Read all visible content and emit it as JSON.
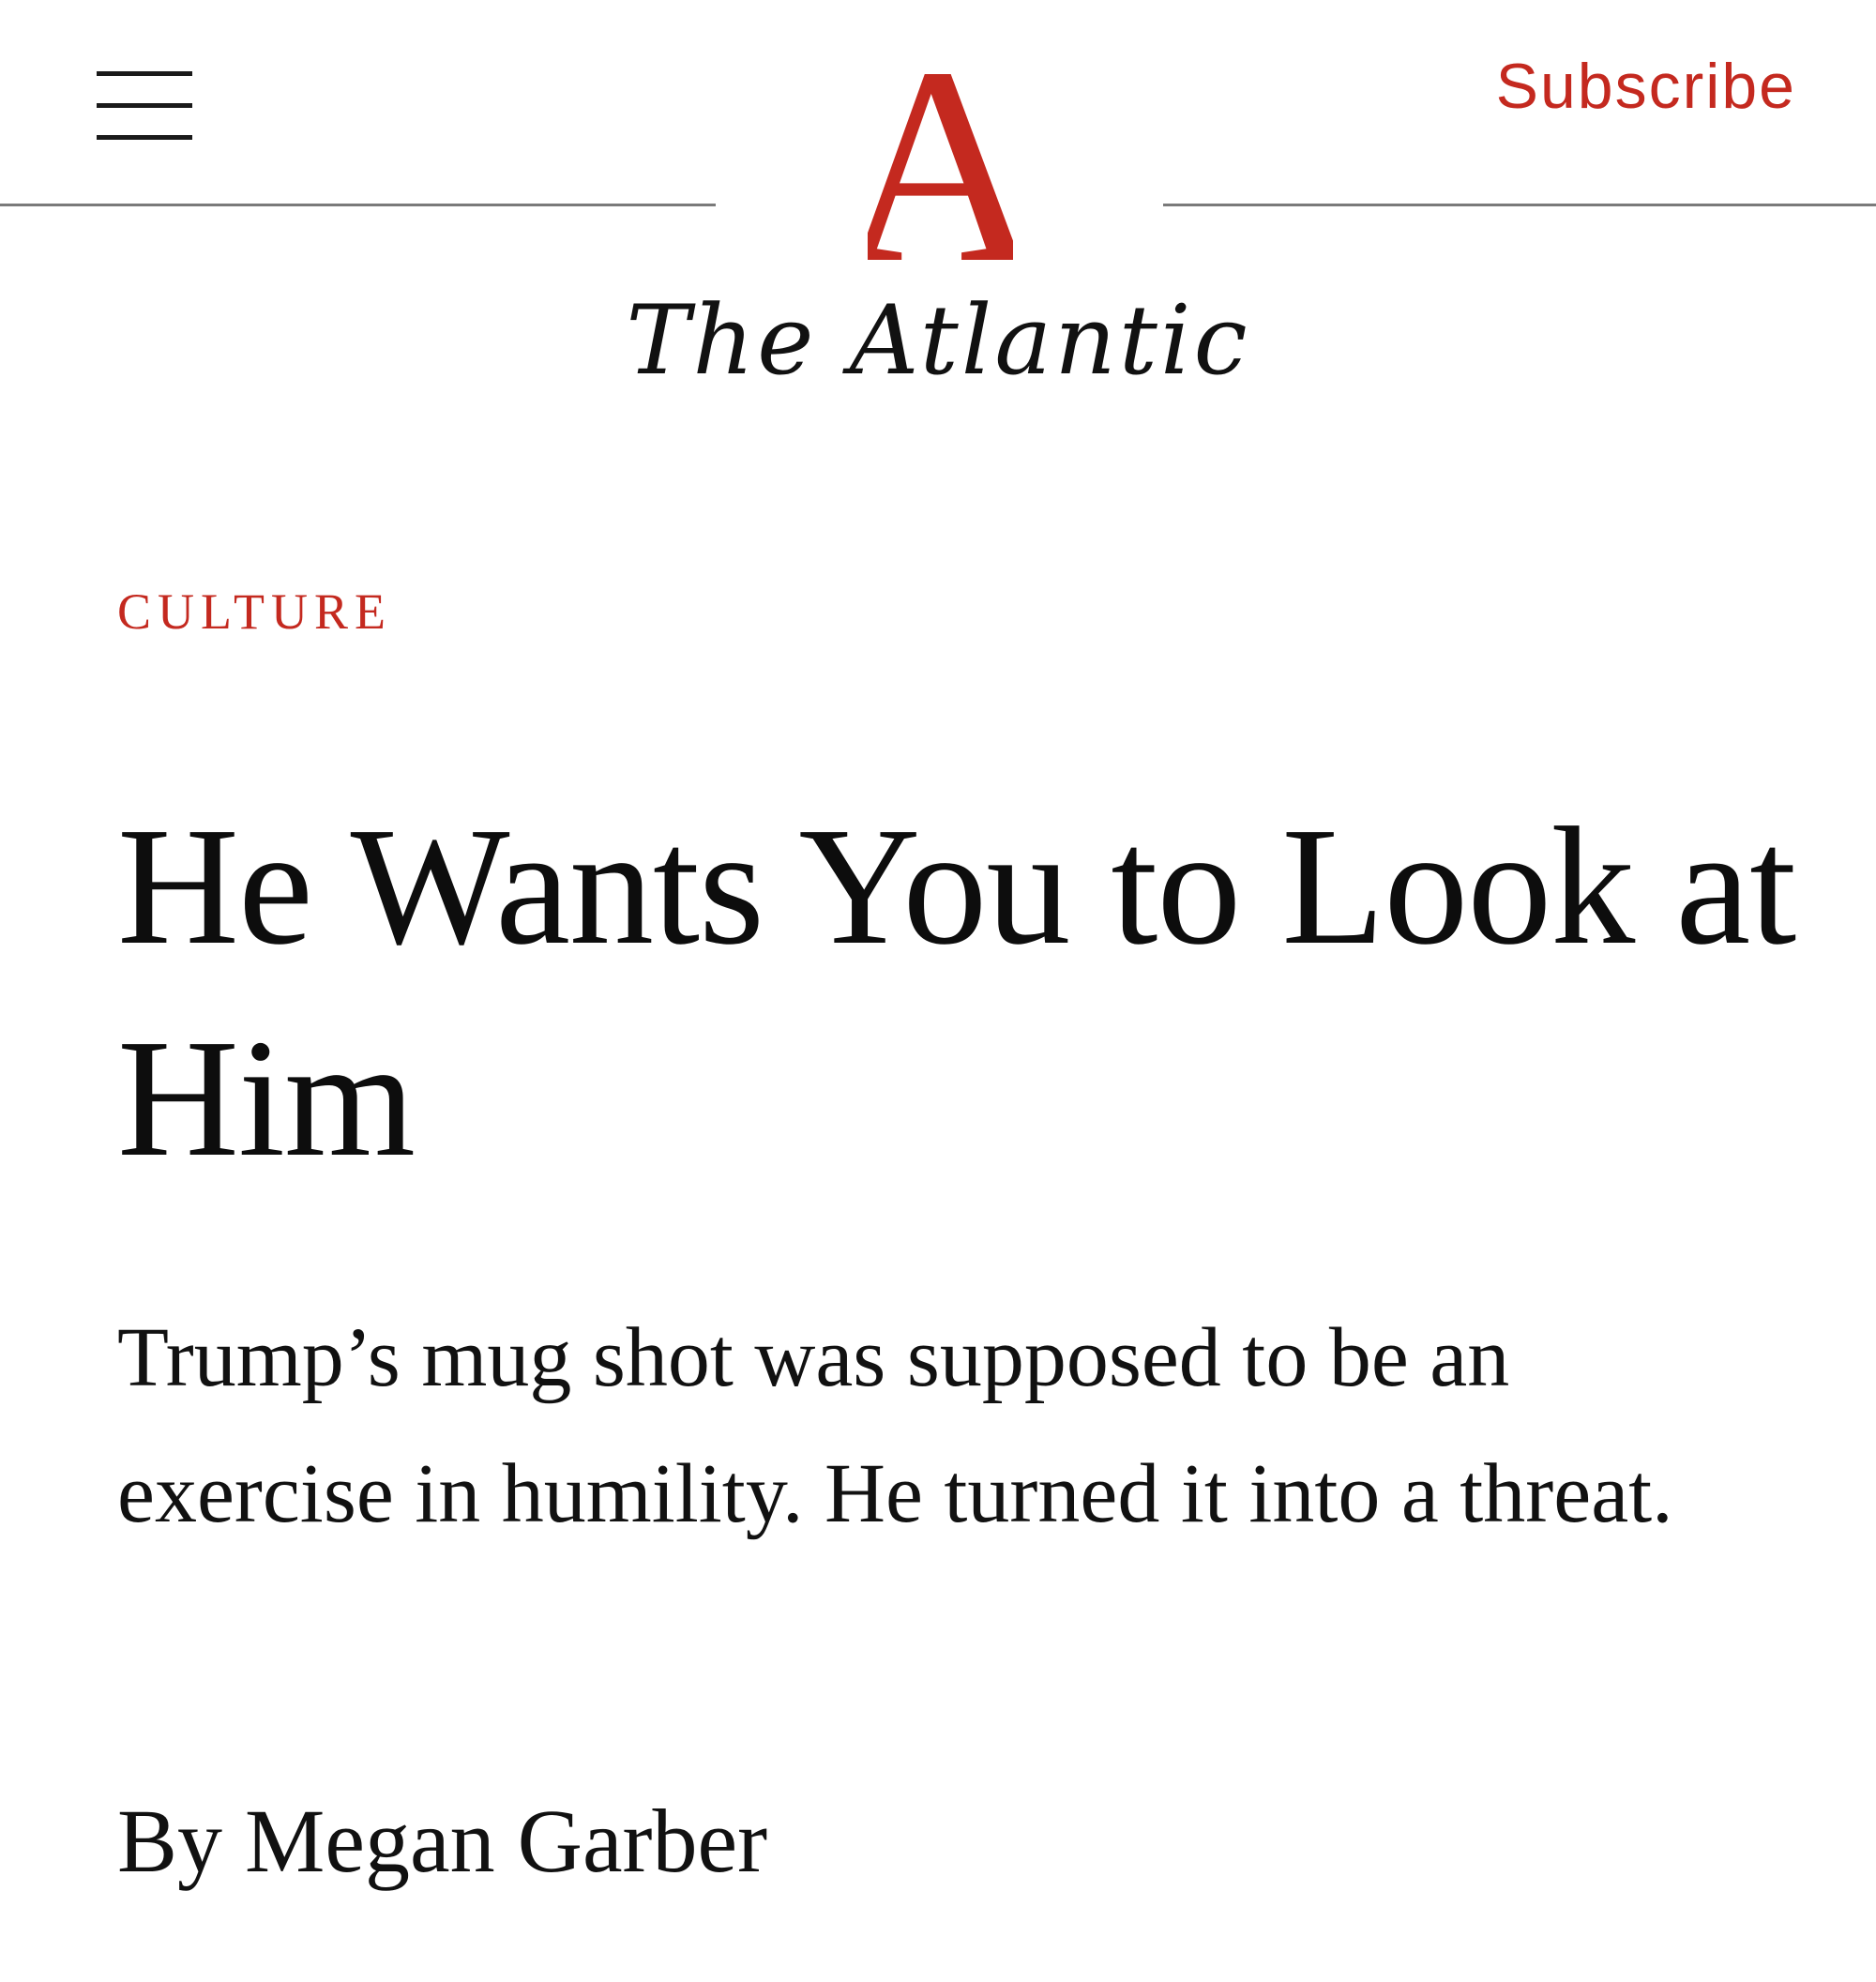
{
  "header": {
    "subscribe_label": "Subscribe",
    "logo_letter": "A",
    "wordmark": "The Atlantic",
    "accent_color": "#c4291f"
  },
  "article": {
    "section": "CULTURE",
    "headline": "He Wants You to Look at Him",
    "dek": "Trump’s mug shot was supposed to be an exercise in humility. He turned it into a threat.",
    "byline_prefix": "By",
    "author": "Megan Garber"
  },
  "icons": {
    "menu": "hamburger-menu-icon"
  }
}
